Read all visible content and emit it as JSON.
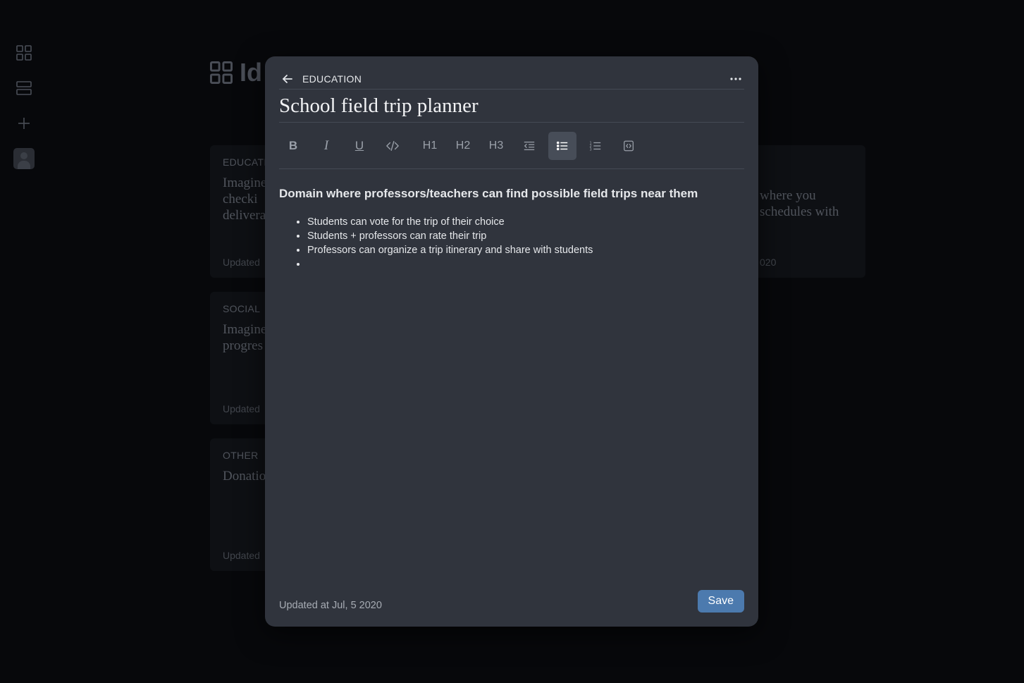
{
  "background": {
    "page_title_partial": "Id",
    "cards": [
      {
        "tag": "EDUCATI",
        "text": "Imagine\nchecki\ndelivera",
        "updated": "Updated"
      },
      {
        "tag": "SOCIAL",
        "text": "Imagine\nprogres",
        "updated": "Updated"
      },
      {
        "tag": "OTHER",
        "text": "Donatio",
        "updated": "Updated"
      }
    ],
    "right_card": {
      "text": "where you\nschedules with",
      "updated": "020"
    }
  },
  "modal": {
    "category": "EDUCATION",
    "title": "School field trip planner",
    "toolbar": {
      "bold": "B",
      "italic": "I",
      "underline": "U",
      "h1": "H1",
      "h2": "H2",
      "h3": "H3"
    },
    "content": {
      "heading": "Domain where professors/teachers can find possible field trips near them",
      "bullets": [
        "Students can vote for the trip of their choice",
        "Students + professors can rate their trip",
        "Professors can organize a trip itinerary and share with students",
        ""
      ]
    },
    "updated_text": "Updated at Jul, 5 2020",
    "save_label": "Save"
  },
  "colors": {
    "modal_bg": "#30343d",
    "accent": "#4c7aae",
    "page_bg": "#07080b"
  }
}
